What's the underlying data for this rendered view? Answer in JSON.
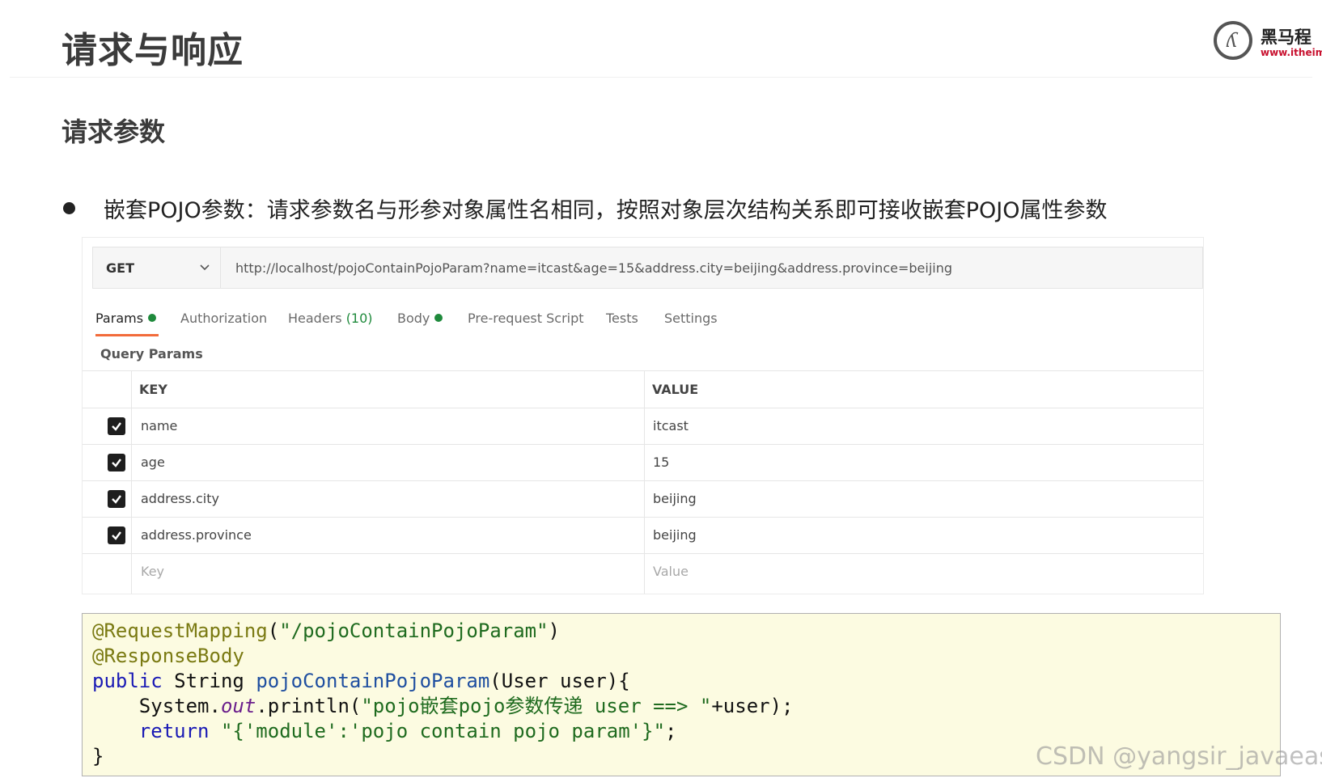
{
  "header": {
    "title": "请求与响应",
    "logo_name": "黑马程",
    "logo_url": "www.itheim"
  },
  "section": {
    "title": "请求参数"
  },
  "bullet": {
    "text": "嵌套POJO参数：请求参数名与形参对象属性名相同，按照对象层次结构关系即可接收嵌套POJO属性参数"
  },
  "postman": {
    "method": "GET",
    "url": "http://localhost/pojoContainPojoParam?name=itcast&age=15&address.city=beijing&address.province=beijing",
    "tabs": [
      {
        "label": "Params",
        "has_dot": true
      },
      {
        "label": "Authorization"
      },
      {
        "label": "Headers",
        "count": "(10)"
      },
      {
        "label": "Body",
        "has_dot": true
      },
      {
        "label": "Pre-request Script"
      },
      {
        "label": "Tests"
      },
      {
        "label": "Settings"
      }
    ],
    "query_params_label": "Query Params",
    "columns": {
      "key": "KEY",
      "value": "VALUE"
    },
    "rows": [
      {
        "key": "name",
        "value": "itcast",
        "checked": true
      },
      {
        "key": "age",
        "value": "15",
        "checked": true
      },
      {
        "key": "address.city",
        "value": "beijing",
        "checked": true
      },
      {
        "key": "address.province",
        "value": "beijing",
        "checked": true
      }
    ],
    "placeholders": {
      "key": "Key",
      "value": "Value"
    }
  },
  "code": {
    "l1_ann": "@RequestMapping",
    "l1_arg": "\"/pojoContainPojoParam\"",
    "l2_ann": "@ResponseBody",
    "l3_kw": "public",
    "l3_type": "String",
    "l3_method": "pojoContainPojoParam",
    "l3_params": "(User user){",
    "l4_obj": "System.",
    "l4_field": "out",
    "l4_call": ".println(",
    "l4_str": "\"pojo嵌套pojo参数传递 user ==> \"",
    "l4_tail": "+user);",
    "l5_kw": "return",
    "l5_str": "\"{'module':'pojo contain pojo param'}\"",
    "l5_tail": ";",
    "l6": "}"
  },
  "watermark": "CSDN @yangsir_javaeasy",
  "colors": {
    "accent_tab": "#f26b3a",
    "status_green": "#1f8a3c",
    "code_bg": "#fcfbe1"
  }
}
